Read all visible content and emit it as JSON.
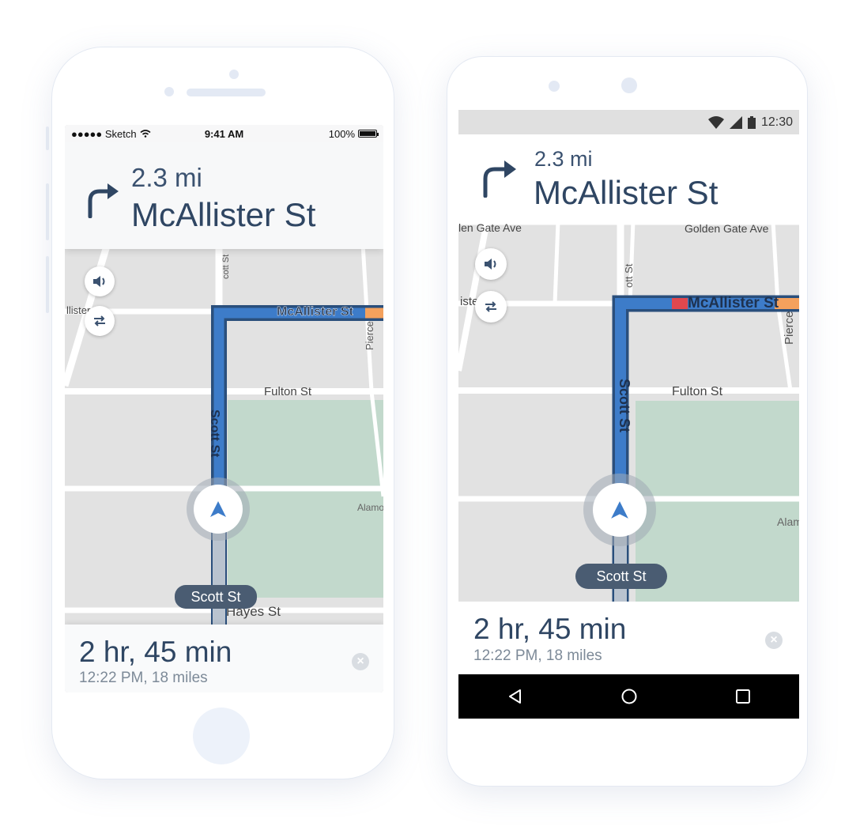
{
  "ios": {
    "status": {
      "carrier": "●●●●● Sketch",
      "time": "9:41 AM",
      "battery": "100%"
    },
    "nav": {
      "distance": "2.3 mi",
      "street": "McAllister St",
      "turn_icon": "turn-right-icon"
    },
    "map_labels": {
      "mcallister": "McAllister St",
      "scott": "Scott St",
      "fulton": "Fulton St",
      "hayes": "Hayes St",
      "pierce": "Pierce",
      "alamo": "Alamo",
      "mcallister_left": "llister",
      "scott_top": "cott St"
    },
    "current_street": "Scott St",
    "eta": "2 hr, 45 min",
    "eta_sub": "12:22 PM, 18 miles"
  },
  "android": {
    "status": {
      "time": "12:30"
    },
    "nav": {
      "distance": "2.3 mi",
      "street": "McAllister St",
      "turn_icon": "turn-right-icon"
    },
    "map_labels": {
      "golden_gate_left": "len Gate Ave",
      "golden_gate_right": "Golden Gate Ave",
      "mcallister": "McAllister St",
      "scott": "Scott St",
      "fulton": "Fulton St",
      "pierce": "Pierce",
      "alamo": "Alam",
      "mcallister_left": "iste",
      "scott_top": "ott St"
    },
    "current_street": "Scott St",
    "eta": "2 hr, 45 min",
    "eta_sub": "12:22 PM, 18 miles"
  },
  "colors": {
    "route": "#3d7cc9",
    "route_outline": "#2a4f7c",
    "park": "#c2d9cc",
    "map_bg": "#e2e2e2",
    "road": "#ffffff",
    "traffic_orange": "#f4a15d",
    "traffic_red": "#e0484e"
  }
}
